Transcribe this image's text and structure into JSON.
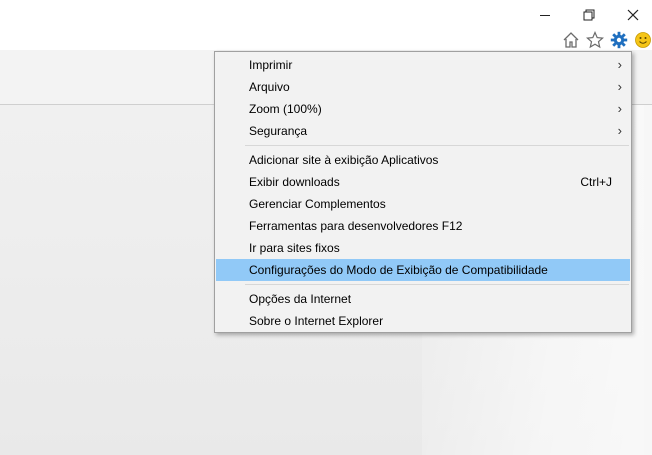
{
  "menu": {
    "items": [
      {
        "label": "Imprimir",
        "has_submenu": true,
        "arrow": "›"
      },
      {
        "label": "Arquivo",
        "has_submenu": true,
        "arrow": "›"
      },
      {
        "label": "Zoom (100%)",
        "has_submenu": true,
        "arrow": "›"
      },
      {
        "label": "Segurança",
        "has_submenu": true,
        "arrow": "›"
      },
      {
        "label": "Adicionar site à exibição Aplicativos"
      },
      {
        "label": "Exibir downloads",
        "shortcut": "Ctrl+J"
      },
      {
        "label": "Gerenciar Complementos"
      },
      {
        "label": "Ferramentas para desenvolvedores F12"
      },
      {
        "label": "Ir para sites fixos"
      },
      {
        "label": "Configurações do Modo de Exibição de Compatibilidade",
        "highlighted": true
      },
      {
        "label": "Opções da Internet"
      },
      {
        "label": "Sobre o Internet Explorer"
      }
    ]
  },
  "icons": {
    "home": "home-icon",
    "favorites": "star-icon",
    "tools": "gear-icon",
    "feedback": "smiley-icon",
    "minimize": "minimize-icon",
    "restore": "restore-icon",
    "close": "close-icon"
  },
  "colors": {
    "highlight": "#91c9f7",
    "gear": "#1f6fbf",
    "smiley": "#f5c518"
  }
}
